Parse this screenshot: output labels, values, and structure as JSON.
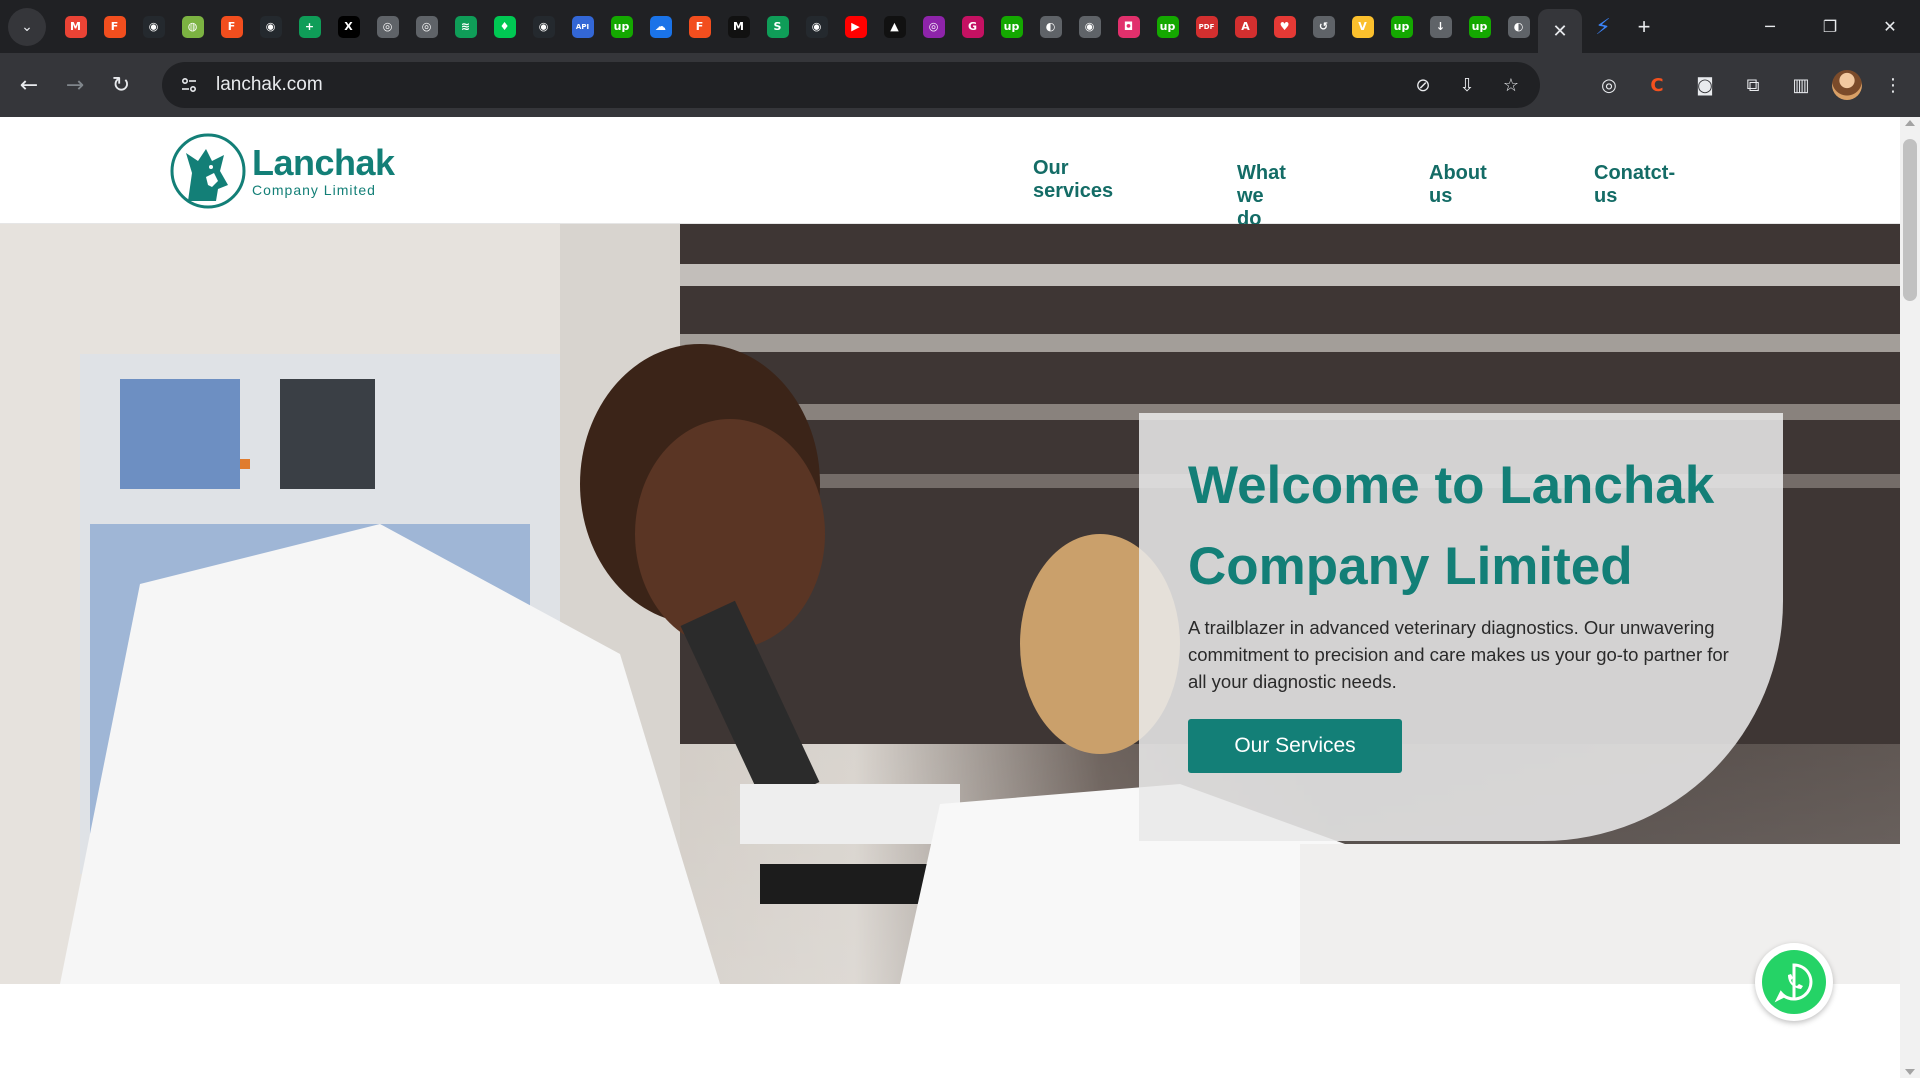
{
  "browser": {
    "url": "lanchak.com",
    "tab_close_glyph": "✕",
    "new_tab_glyph": "+",
    "favicons": [
      {
        "name": "gmail-icon",
        "color": "#ea4335",
        "glyph": "M"
      },
      {
        "name": "figma-icon",
        "color": "#f24e1e",
        "glyph": "F"
      },
      {
        "name": "github-icon",
        "color": "#24292e",
        "glyph": "◉"
      },
      {
        "name": "web-icon",
        "color": "#7cb342",
        "glyph": "◍"
      },
      {
        "name": "figma-icon",
        "color": "#f24e1e",
        "glyph": "F"
      },
      {
        "name": "github-icon",
        "color": "#24292e",
        "glyph": "◉"
      },
      {
        "name": "sheets-icon",
        "color": "#0f9d58",
        "glyph": "+"
      },
      {
        "name": "x-icon",
        "color": "#000000",
        "glyph": "X"
      },
      {
        "name": "app-icon",
        "color": "#5f6368",
        "glyph": "◎"
      },
      {
        "name": "app-icon",
        "color": "#5f6368",
        "glyph": "◎"
      },
      {
        "name": "layers-icon",
        "color": "#0f9d58",
        "glyph": "≋"
      },
      {
        "name": "leaf-icon",
        "color": "#00c853",
        "glyph": "♦"
      },
      {
        "name": "github-icon",
        "color": "#24292e",
        "glyph": "◉"
      },
      {
        "name": "api-icon",
        "color": "#3367d6",
        "glyph": "API"
      },
      {
        "name": "upwork-icon",
        "color": "#14a800",
        "glyph": "up"
      },
      {
        "name": "cloud-icon",
        "color": "#1a73e8",
        "glyph": "☁"
      },
      {
        "name": "figma-icon",
        "color": "#f24e1e",
        "glyph": "F"
      },
      {
        "name": "medium-icon",
        "color": "#111111",
        "glyph": "M"
      },
      {
        "name": "s-icon",
        "color": "#0f9d58",
        "glyph": "S"
      },
      {
        "name": "github-icon",
        "color": "#24292e",
        "glyph": "◉"
      },
      {
        "name": "youtube-icon",
        "color": "#ff0000",
        "glyph": "▶"
      },
      {
        "name": "triangle-icon",
        "color": "#111111",
        "glyph": "▲"
      },
      {
        "name": "ring-icon",
        "color": "#8e24aa",
        "glyph": "◎"
      },
      {
        "name": "g-icon",
        "color": "#c51162",
        "glyph": "G"
      },
      {
        "name": "upwork-icon",
        "color": "#14a800",
        "glyph": "up"
      },
      {
        "name": "globe-icon",
        "color": "#5f6368",
        "glyph": "◐"
      },
      {
        "name": "chrome-icon",
        "color": "#5f6368",
        "glyph": "◉"
      },
      {
        "name": "instagram-icon",
        "color": "#e1306c",
        "glyph": "◘"
      },
      {
        "name": "upwork-icon",
        "color": "#14a800",
        "glyph": "up"
      },
      {
        "name": "pdf-icon",
        "color": "#d32f2f",
        "glyph": "PDF"
      },
      {
        "name": "acrobat-icon",
        "color": "#d32f2f",
        "glyph": "A"
      },
      {
        "name": "heart-icon",
        "color": "#e53935",
        "glyph": "♥"
      },
      {
        "name": "history-icon",
        "color": "#5f6368",
        "glyph": "↺"
      },
      {
        "name": "vuetify-icon",
        "color": "#fbc02d",
        "glyph": "V"
      },
      {
        "name": "upwork-icon",
        "color": "#14a800",
        "glyph": "up"
      },
      {
        "name": "download-icon",
        "color": "#5f6368",
        "glyph": "↓"
      },
      {
        "name": "upwork-icon",
        "color": "#14a800",
        "glyph": "up"
      },
      {
        "name": "globe-icon",
        "color": "#5f6368",
        "glyph": "◐"
      }
    ]
  },
  "site": {
    "logo": {
      "name": "Lanchak",
      "sub": "Company Limited"
    },
    "nav": [
      "Our services",
      "What we do",
      "About us",
      "Conatct-us"
    ],
    "hero": {
      "title": "Welcome to Lanchak Company Limited",
      "description": "A trailblazer in advanced veterinary diagnostics. Our unwavering commitment to precision and care makes us your go-to partner for all your diagnostic needs.",
      "cta": "Our Services"
    }
  },
  "colors": {
    "brand": "#137f77",
    "whatsapp": "#25d366",
    "chrome_dark": "#202124",
    "chrome_toolbar": "#35363a"
  }
}
